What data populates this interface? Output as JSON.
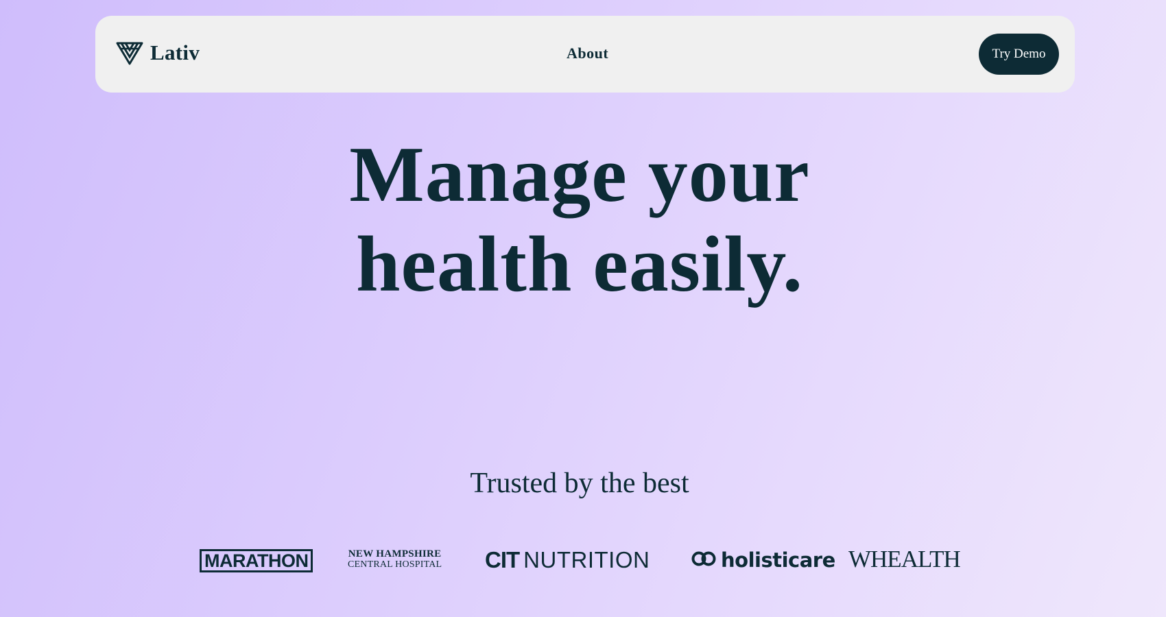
{
  "header": {
    "brand": {
      "name": "Lativ",
      "icon": "lativ-logo-icon"
    },
    "nav_links": [
      {
        "label": "About"
      }
    ],
    "cta_label": "Try Demo"
  },
  "hero": {
    "title_lines": [
      "Manage your",
      "health easily."
    ]
  },
  "trusted": {
    "heading": "Trusted by the best",
    "logos": [
      {
        "name": "marathon",
        "text": "MARATHON"
      },
      {
        "name": "new-hampshire-central-hospital",
        "line1": "NEW HAMPSHIRE",
        "line2": "CENTRAL HOSPITAL"
      },
      {
        "name": "cit-nutrition",
        "part1": "CIT",
        "part2": "NUTRITION"
      },
      {
        "name": "holisticare",
        "text": "holisticare",
        "icon": "infinity-icon"
      },
      {
        "name": "whealth",
        "text": "WHEALTH"
      }
    ]
  },
  "colors": {
    "primary": "#0d2b35",
    "nav_background": "#f0f0f0",
    "background_start": "#cfbdfc",
    "background_end": "#efe7fc",
    "button_text": "#ffffff"
  }
}
